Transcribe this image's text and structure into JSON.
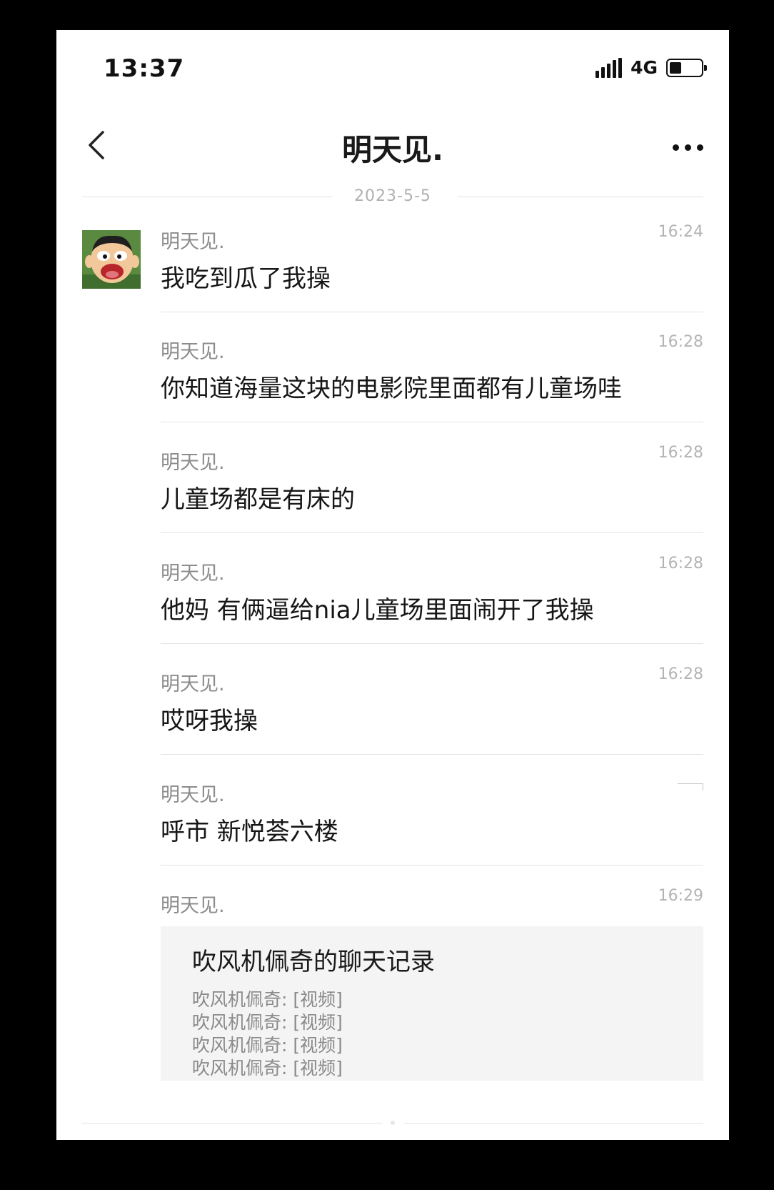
{
  "status_bar": {
    "time": "13:37",
    "network": "4G",
    "battery_level": 0.4
  },
  "nav": {
    "title": "明天见.",
    "back_icon": "chevron-left-icon",
    "more_icon": "more-dots-icon"
  },
  "date_divider": "2023-5-5",
  "messages": [
    {
      "sender": "明天见.",
      "time": "16:24",
      "text": "我吃到瓜了我操"
    },
    {
      "sender": "明天见.",
      "time": "16:28",
      "text": "你知道海量这块的电影院里面都有儿童场哇"
    },
    {
      "sender": "明天见.",
      "time": "16:28",
      "text": "儿童场都是有床的"
    },
    {
      "sender": "明天见.",
      "time": "16:28",
      "text": "他妈 有俩逼给nia儿童场里面闹开了我操"
    },
    {
      "sender": "明天见.",
      "time": "16:28",
      "text": "哎呀我操"
    },
    {
      "sender": "明天见.",
      "time": "",
      "text": "呼市 新悦荟六楼"
    }
  ],
  "record_message": {
    "sender": "明天见.",
    "time": "16:29",
    "card_title": "吹风机佩奇的聊天记录",
    "lines": [
      "吹风机佩奇: [视频]",
      "吹风机佩奇: [视频]",
      "吹风机佩奇: [视频]",
      "吹风机佩奇: [视频]"
    ]
  },
  "colors": {
    "background": "#ffffff",
    "frame": "#000000",
    "secondary_text": "#8c8c8c",
    "card_bg": "#f4f4f4"
  }
}
